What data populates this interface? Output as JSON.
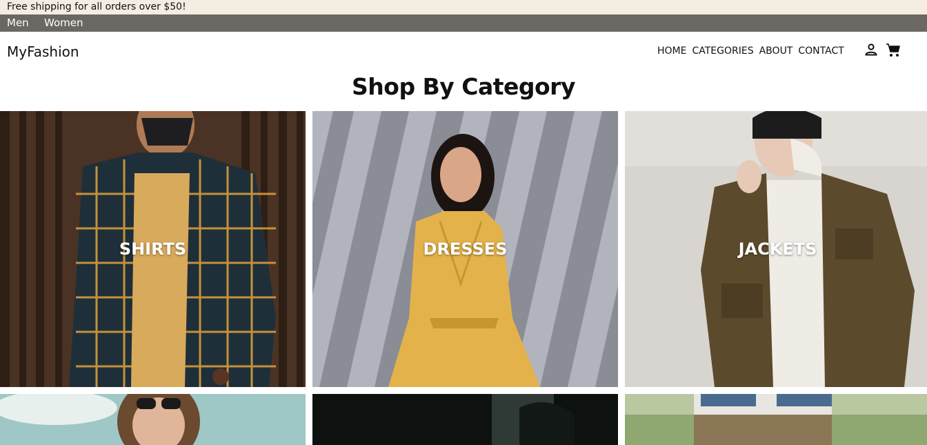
{
  "announcement": "Free shipping for all orders over $50!",
  "gender_nav": [
    "Men",
    "Women"
  ],
  "brand": "MyFashion",
  "nav": [
    "HOME",
    "CATEGORIES",
    "ABOUT",
    "CONTACT"
  ],
  "icons": {
    "account": "person-icon",
    "cart": "cart-icon"
  },
  "section_title": "Shop By Category",
  "categories": [
    {
      "label": "SHIRTS"
    },
    {
      "label": "DRESSES"
    },
    {
      "label": "JACKETS"
    }
  ],
  "colors": {
    "announce_bg": "#f5ece2",
    "gender_bar_bg": "#6b6863",
    "text": "#111111"
  }
}
